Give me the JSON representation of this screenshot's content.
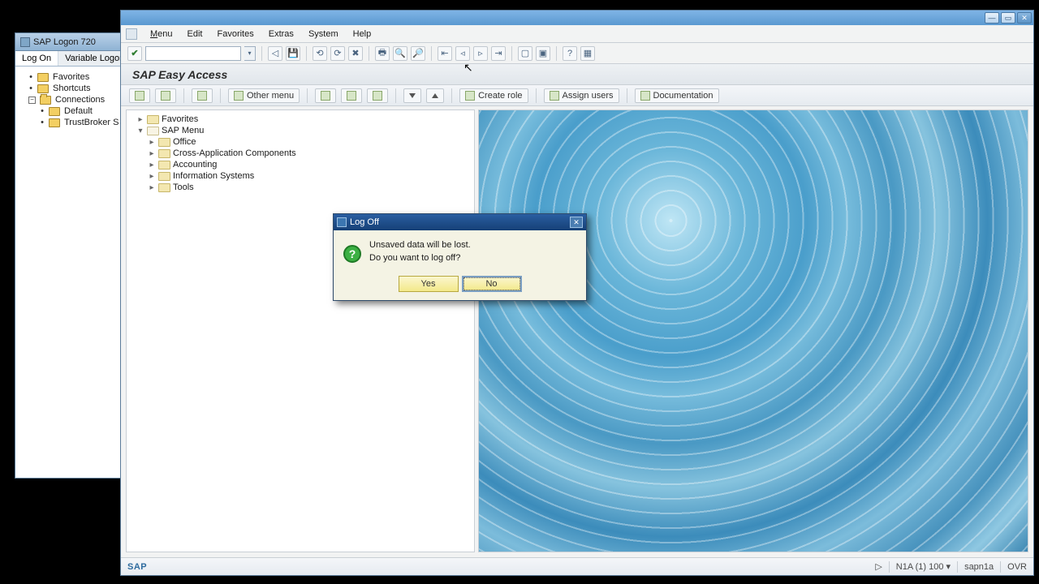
{
  "logon": {
    "title": "SAP Logon 720",
    "tabs": {
      "logon": "Log On",
      "variable": "Variable Logon…"
    },
    "tree": {
      "favorites": "Favorites",
      "shortcuts": "Shortcuts",
      "connections": "Connections",
      "default": "Default",
      "trustbroker": "TrustBroker S"
    }
  },
  "menu": {
    "menu": "Menu",
    "edit": "Edit",
    "favorites": "Favorites",
    "extras": "Extras",
    "system": "System",
    "help": "Help"
  },
  "page_title": "SAP Easy Access",
  "toolbar2": {
    "other_menu": "Other menu",
    "create_role": "Create role",
    "assign_users": "Assign users",
    "documentation": "Documentation"
  },
  "tree": {
    "favorites": "Favorites",
    "sap_menu": "SAP Menu",
    "office": "Office",
    "cross_app": "Cross-Application Components",
    "accounting": "Accounting",
    "info_sys": "Information Systems",
    "tools": "Tools"
  },
  "dialog": {
    "title": "Log Off",
    "line1": "Unsaved data will be lost.",
    "line2": "Do you want to log off?",
    "yes": "Yes",
    "no": "No"
  },
  "status": {
    "system": "N1A (1) 100",
    "host": "sapn1a",
    "mode": "OVR",
    "logo": "SAP"
  }
}
